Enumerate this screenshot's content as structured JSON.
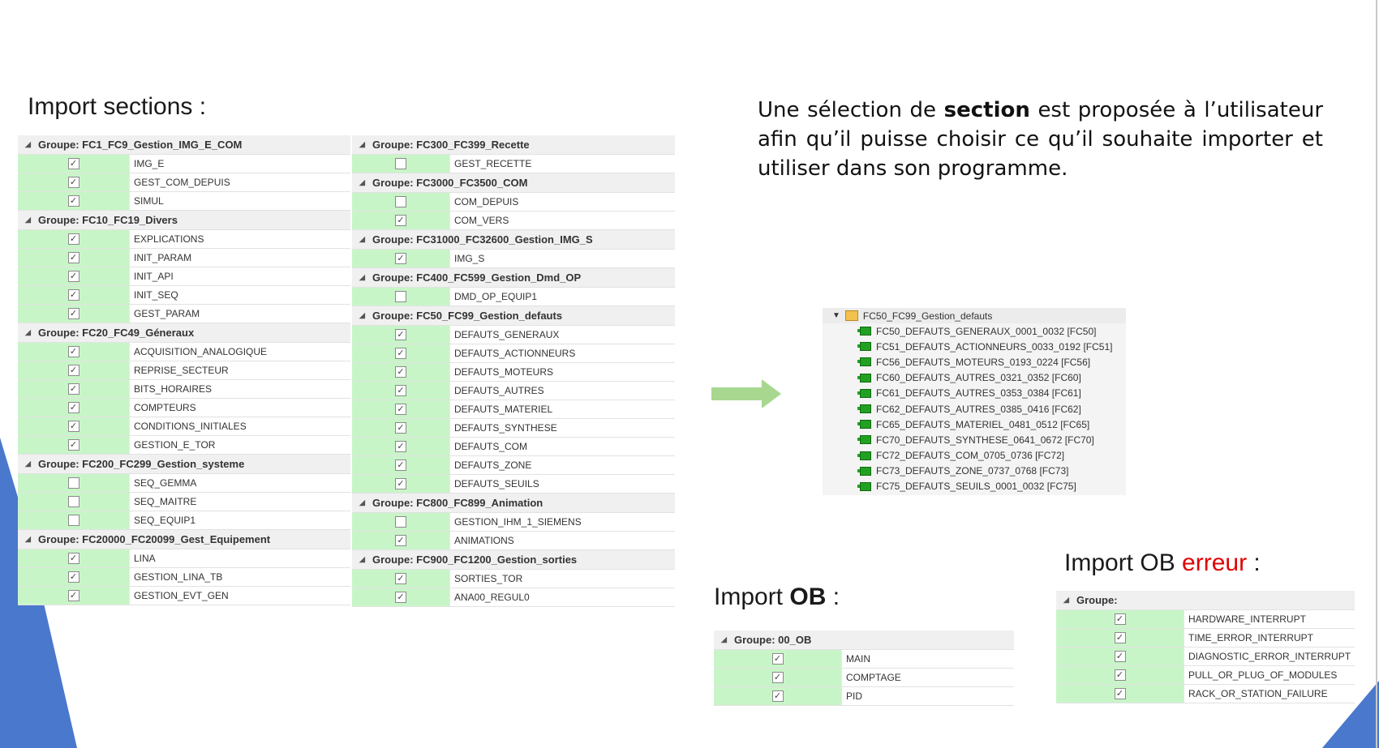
{
  "headings": {
    "import_sections": "Import sections :",
    "import_ob_prefix": "Import ",
    "import_ob_bold": "OB",
    "import_ob_suffix": " :",
    "import_ob_err_prefix": "Import OB ",
    "import_ob_err_red": "erreur",
    "import_ob_err_suffix": " :"
  },
  "paragraph": {
    "part1": "Une sélection de ",
    "bold": "section",
    "part2": " est proposée à l’utilisateur afin qu’il puisse choisir ce qu’il souhaite importer et utiliser dans son programme."
  },
  "colors": {
    "row_green": "#c8f5c8",
    "arrow_green": "#a8d890",
    "accent_blue": "#4472c4",
    "error_red": "#e00000"
  },
  "left_col": [
    {
      "group": "Groupe: FC1_FC9_Gestion_IMG_E_COM",
      "items": [
        {
          "name": "IMG_E",
          "checked": true
        },
        {
          "name": "GEST_COM_DEPUIS",
          "checked": true
        },
        {
          "name": "SIMUL",
          "checked": true
        }
      ]
    },
    {
      "group": "Groupe: FC10_FC19_Divers",
      "items": [
        {
          "name": "EXPLICATIONS",
          "checked": true
        },
        {
          "name": "INIT_PARAM",
          "checked": true
        },
        {
          "name": "INIT_API",
          "checked": true
        },
        {
          "name": "INIT_SEQ",
          "checked": true
        },
        {
          "name": "GEST_PARAM",
          "checked": true
        }
      ]
    },
    {
      "group": "Groupe: FC20_FC49_Géneraux",
      "items": [
        {
          "name": "ACQUISITION_ANALOGIQUE",
          "checked": true
        },
        {
          "name": "REPRISE_SECTEUR",
          "checked": true
        },
        {
          "name": "BITS_HORAIRES",
          "checked": true
        },
        {
          "name": "COMPTEURS",
          "checked": true
        },
        {
          "name": "CONDITIONS_INITIALES",
          "checked": true
        },
        {
          "name": "GESTION_E_TOR",
          "checked": true
        }
      ]
    },
    {
      "group": "Groupe: FC200_FC299_Gestion_systeme",
      "items": [
        {
          "name": "SEQ_GEMMA",
          "checked": false
        },
        {
          "name": "SEQ_MAITRE",
          "checked": false
        },
        {
          "name": "SEQ_EQUIP1",
          "checked": false
        }
      ]
    },
    {
      "group": "Groupe: FC20000_FC20099_Gest_Equipement",
      "items": [
        {
          "name": "LINA",
          "checked": true
        },
        {
          "name": "GESTION_LINA_TB",
          "checked": true
        },
        {
          "name": "GESTION_EVT_GEN",
          "checked": true
        }
      ]
    }
  ],
  "right_col": [
    {
      "group": "Groupe: FC300_FC399_Recette",
      "items": [
        {
          "name": "GEST_RECETTE",
          "checked": false
        }
      ]
    },
    {
      "group": "Groupe: FC3000_FC3500_COM",
      "items": [
        {
          "name": "COM_DEPUIS",
          "checked": false
        },
        {
          "name": "COM_VERS",
          "checked": true
        }
      ]
    },
    {
      "group": "Groupe: FC31000_FC32600_Gestion_IMG_S",
      "items": [
        {
          "name": "IMG_S",
          "checked": true
        }
      ]
    },
    {
      "group": "Groupe: FC400_FC599_Gestion_Dmd_OP",
      "items": [
        {
          "name": "DMD_OP_EQUIP1",
          "checked": false
        }
      ]
    },
    {
      "group": "Groupe: FC50_FC99_Gestion_defauts",
      "items": [
        {
          "name": "DEFAUTS_GENERAUX",
          "checked": true
        },
        {
          "name": "DEFAUTS_ACTIONNEURS",
          "checked": true
        },
        {
          "name": "DEFAUTS_MOTEURS",
          "checked": true
        },
        {
          "name": "DEFAUTS_AUTRES",
          "checked": true
        },
        {
          "name": "DEFAUTS_MATERIEL",
          "checked": true
        },
        {
          "name": "DEFAUTS_SYNTHESE",
          "checked": true
        },
        {
          "name": "DEFAUTS_COM",
          "checked": true
        },
        {
          "name": "DEFAUTS_ZONE",
          "checked": true
        },
        {
          "name": "DEFAUTS_SEUILS",
          "checked": true
        }
      ]
    },
    {
      "group": "Groupe: FC800_FC899_Animation",
      "items": [
        {
          "name": "GESTION_IHM_1_SIEMENS",
          "checked": false
        },
        {
          "name": "ANIMATIONS",
          "checked": true
        }
      ]
    },
    {
      "group": "Groupe: FC900_FC1200_Gestion_sorties",
      "items": [
        {
          "name": "SORTIES_TOR",
          "checked": true
        },
        {
          "name": "ANA00_REGUL0",
          "checked": true
        }
      ]
    }
  ],
  "tree": {
    "root": "FC50_FC99_Gestion_defauts",
    "items": [
      "FC50_DEFAUTS_GENERAUX_0001_0032 [FC50]",
      "FC51_DEFAUTS_ACTIONNEURS_0033_0192 [FC51]",
      "FC56_DEFAUTS_MOTEURS_0193_0224 [FC56]",
      "FC60_DEFAUTS_AUTRES_0321_0352 [FC60]",
      "FC61_DEFAUTS_AUTRES_0353_0384 [FC61]",
      "FC62_DEFAUTS_AUTRES_0385_0416 [FC62]",
      "FC65_DEFAUTS_MATERIEL_0481_0512 [FC65]",
      "FC70_DEFAUTS_SYNTHESE_0641_0672 [FC70]",
      "FC72_DEFAUTS_COM_0705_0736 [FC72]",
      "FC73_DEFAUTS_ZONE_0737_0768 [FC73]",
      "FC75_DEFAUTS_SEUILS_0001_0032 [FC75]"
    ]
  },
  "ob_table": [
    {
      "group": "Groupe: 00_OB",
      "items": [
        {
          "name": "MAIN",
          "checked": true
        },
        {
          "name": "COMPTAGE",
          "checked": true
        },
        {
          "name": "PID",
          "checked": true
        }
      ]
    }
  ],
  "ob_err_table": [
    {
      "group": "Groupe:",
      "items": [
        {
          "name": "HARDWARE_INTERRUPT",
          "checked": true
        },
        {
          "name": "TIME_ERROR_INTERRUPT",
          "checked": true
        },
        {
          "name": "DIAGNOSTIC_ERROR_INTERRUPT",
          "checked": true
        },
        {
          "name": "PULL_OR_PLUG_OF_MODULES",
          "checked": true
        },
        {
          "name": "RACK_OR_STATION_FAILURE",
          "checked": true
        }
      ]
    }
  ]
}
